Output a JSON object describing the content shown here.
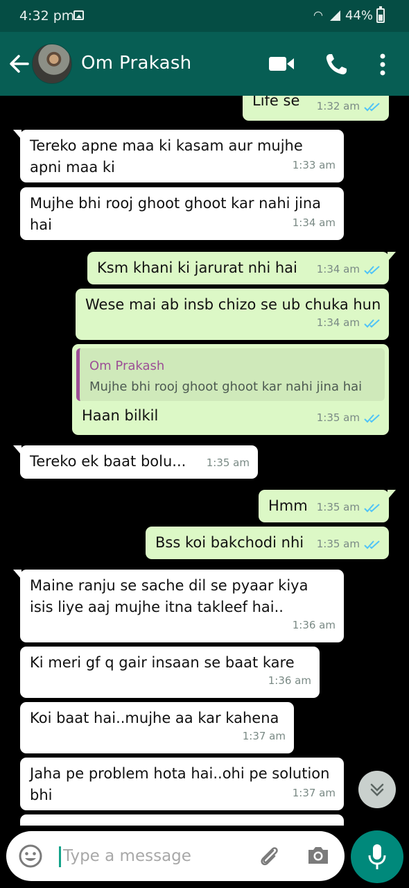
{
  "status_bar": {
    "time": "4:32 pm",
    "battery": "44%"
  },
  "header": {
    "contact_name": "Om Prakash"
  },
  "messages": [
    {
      "dir": "out",
      "text": "Life se",
      "time": "1:32 am"
    },
    {
      "dir": "in",
      "lines": [
        "Tereko apne maa ki kasam aur mujhe",
        "apni maa ki"
      ],
      "time": "1:33 am"
    },
    {
      "dir": "in",
      "lines": [
        "Mujhe bhi rooj ghoot ghoot kar nahi jina",
        "hai"
      ],
      "time": "1:34 am"
    },
    {
      "dir": "out",
      "text": "Ksm khani ki jarurat nhi hai",
      "time": "1:34 am"
    },
    {
      "dir": "out",
      "text": "Wese mai ab insb chizo se ub chuka hun",
      "time": "1:34 am"
    },
    {
      "dir": "out",
      "quote_name": "Om Prakash",
      "quote_text": "Mujhe bhi rooj ghoot ghoot kar nahi jina hai",
      "text": "Haan bilkil",
      "time": "1:35 am"
    },
    {
      "dir": "in",
      "text": "Tereko ek baat bolu...",
      "time": "1:35 am"
    },
    {
      "dir": "out",
      "text": "Hmm",
      "time": "1:35 am"
    },
    {
      "dir": "out",
      "text": "Bss koi bakchodi nhi",
      "time": "1:35 am"
    },
    {
      "dir": "in",
      "lines": [
        "Maine ranju se sache dil se pyaar kiya",
        "isis liye aaj mujhe itna takleef hai.."
      ],
      "time": "1:36 am"
    },
    {
      "dir": "in",
      "text": "Ki meri gf q gair insaan se baat kare",
      "time": "1:36 am"
    },
    {
      "dir": "in",
      "text": "Koi baat hai..mujhe aa kar kahena",
      "time": "1:37 am"
    },
    {
      "dir": "in",
      "lines": [
        "Jaha pe problem hota hai..ohi pe solution",
        "bhi"
      ],
      "time": "1:37 am"
    }
  ],
  "input": {
    "placeholder": "Type a message"
  },
  "colors": {
    "header": "#075e54",
    "status_bar": "#054d44",
    "outgoing_bubble": "#dcf8c6",
    "incoming_bubble": "#ffffff",
    "read_ticks": "#4fc3f7",
    "mic_button": "#00897b"
  }
}
